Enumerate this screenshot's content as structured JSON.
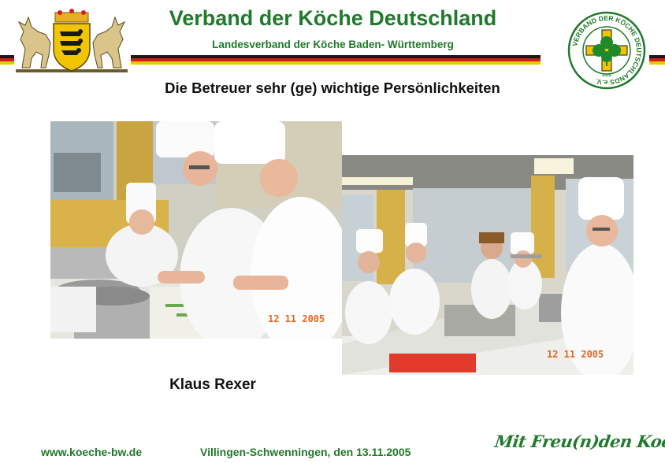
{
  "header": {
    "title": "Verband der Köche Deutschland",
    "subtitle": "Landesverband der Köche Baden- Württemberg",
    "seal_text": "VERBAND DER KÖCHE DEUTSCHLANDS e.V.",
    "seal_stars": "***"
  },
  "slide": {
    "heading": "Die Betreuer sehr (ge) wichtige Persönlichkeiten",
    "caption": "Klaus Rexer"
  },
  "photos": {
    "left": {
      "date_stamp": "12 11 2005"
    },
    "right": {
      "date_stamp": "12 11 2005"
    }
  },
  "footer": {
    "website": "www.koeche-bw.de",
    "location_date": "Villingen-Schwenningen,  den 13.11.2005",
    "slogan": "Mit Freu(n)den Kochen"
  },
  "colors": {
    "brand_green": "#1f7a2a",
    "flag_black": "#1a1a1a",
    "flag_red": "#cc1f1f",
    "flag_gold": "#f2c500"
  }
}
